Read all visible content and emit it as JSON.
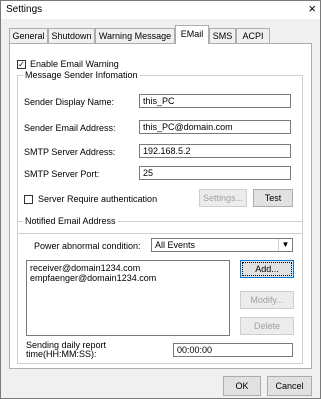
{
  "window": {
    "title": "Settings",
    "close_glyph": "×"
  },
  "tabs": [
    {
      "label": "General"
    },
    {
      "label": "Shutdown"
    },
    {
      "label": "Warning Message"
    },
    {
      "label": "EMail"
    },
    {
      "label": "SMS"
    },
    {
      "label": "ACPI"
    }
  ],
  "email": {
    "enable_label": "Enable Email Warning",
    "enable_checked": true,
    "sender_group": "Message Sender Infomation",
    "display_name_label": "Sender Display Name:",
    "display_name_value": "this_PC",
    "email_label": "Sender Email Address:",
    "email_value": "this_PC@domain.com",
    "smtp_label": "SMTP Server Address:",
    "smtp_value": "192.168.5.2",
    "port_label": "SMTP Server Port:",
    "port_value": "25",
    "auth_label": "Server Require authentication",
    "auth_checked": false,
    "settings_button": "Settings...",
    "test_button": "Test",
    "notified_group": "Notified Email Address",
    "power_label": "Power abnormal condition:",
    "power_value": "All Events",
    "recipients": [
      "receiver@domain1234.com",
      "empfaenger@domain1234.com"
    ],
    "add_button": "Add...",
    "modify_button": "Modify...",
    "delete_button": "Delete",
    "report_label": "Sending daily report time(HH:MM:SS):",
    "report_value": "00:00:00"
  },
  "footer": {
    "ok": "OK",
    "cancel": "Cancel"
  }
}
